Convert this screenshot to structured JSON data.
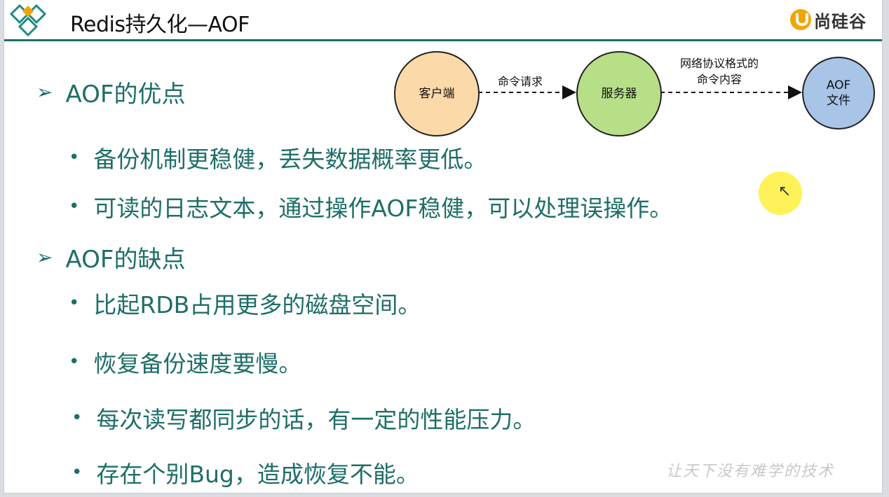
{
  "header": {
    "title": "Redis持久化—AOF",
    "brand": "尚硅谷"
  },
  "diagram": {
    "client": "客户端",
    "server": "服务器",
    "aof_line1": "AOF",
    "aof_line2": "文件",
    "edge1": "命令请求",
    "edge2_line1": "网络协议格式的",
    "edge2_line2": "命令内容"
  },
  "sections": [
    {
      "heading": "AOF的优点",
      "items": [
        "备份机制更稳健，丢失数据概率更低。",
        "可读的日志文本，通过操作AOF稳健，可以处理误操作。"
      ]
    },
    {
      "heading": "AOF的缺点",
      "items": [
        "比起RDB占用更多的磁盘空间。",
        "恢复备份速度要慢。",
        "每次读写都同步的话，有一定的性能压力。",
        "存在个别Bug，造成恢复不能。"
      ]
    }
  ],
  "watermark": "让天下没有难学的技术",
  "colors": {
    "accent": "#1f6e68",
    "client_node": "#fbd9a8",
    "server_node": "#b7df88",
    "aof_node": "#a8c4e6",
    "brand": "#f1a500"
  }
}
